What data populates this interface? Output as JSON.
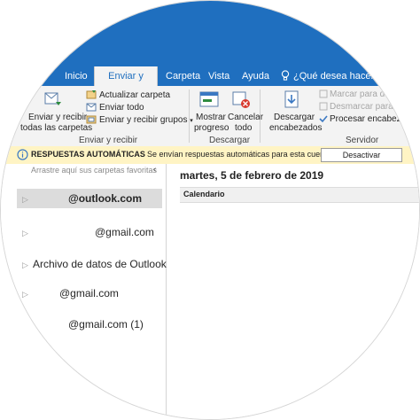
{
  "tabs": [
    "Inicio",
    "Enviar y recibir",
    "Carpeta",
    "Vista",
    "Ayuda"
  ],
  "active_tab": "Enviar y recibir",
  "search": {
    "text": "¿Qué desea hacer?"
  },
  "ribbon": {
    "send_receive_all": [
      "Enviar y recibir",
      "todas las carpetas"
    ],
    "update_folder": "Actualizar carpeta",
    "send_all": "Enviar todo",
    "send_receive_groups": "Enviar y recibir grupos",
    "group_send_receive": "Enviar y recibir",
    "show_progress": [
      "Mostrar",
      "progreso"
    ],
    "cancel_all": [
      "Cancelar",
      "todo"
    ],
    "group_download": "Descargar",
    "download_headers": [
      "Descargar",
      "encabezados"
    ],
    "mark_download": "Marcar para d",
    "unmark_download": "Desmarcar para d",
    "process_headers": "Procesar encabezad",
    "group_server": "Servidor"
  },
  "banner": {
    "title": "RESPUESTAS AUTOMÁTICAS",
    "message": "Se envían respuestas automáticas para esta cuenta.",
    "button": "Desactivar"
  },
  "nav": {
    "hint": "Arrastre aquí sus carpetas favoritas",
    "accounts": [
      "@outlook.com",
      "@gmail.com",
      "Archivo de datos de Outlook...",
      "@gmail.com",
      "@gmail.com (1)"
    ]
  },
  "content": {
    "date": "martes, 5 de febrero de 2019",
    "calendar_header": "Calendario"
  },
  "colors": {
    "brand": "#1f6fbf",
    "banner": "#fff4c4",
    "selected": "#dcdcdc"
  }
}
